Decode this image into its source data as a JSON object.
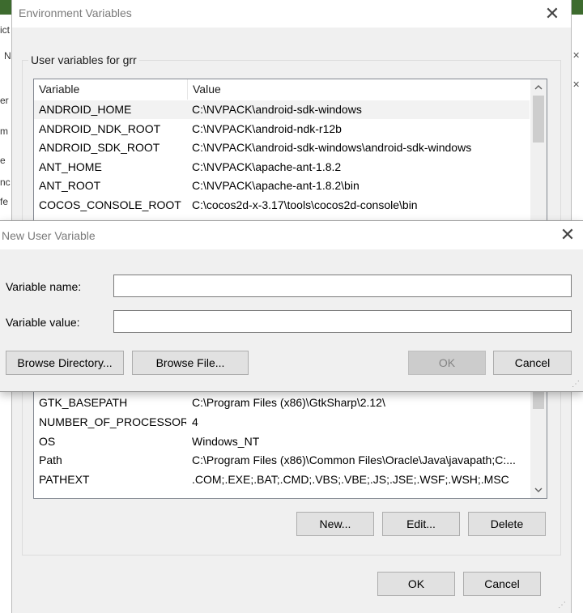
{
  "background": {
    "left_fragments": [
      "ict",
      "N",
      "er",
      "m",
      "e",
      "nc",
      "fe"
    ]
  },
  "env_window": {
    "title": "Environment Variables",
    "group_label": "User variables for grr",
    "columns": [
      "Variable",
      "Value"
    ],
    "rows_top": [
      {
        "name": "ANDROID_HOME",
        "value": "C:\\NVPACK\\android-sdk-windows"
      },
      {
        "name": "ANDROID_NDK_ROOT",
        "value": "C:\\NVPACK\\android-ndk-r12b"
      },
      {
        "name": "ANDROID_SDK_ROOT",
        "value": "C:\\NVPACK\\android-sdk-windows\\android-sdk-windows"
      },
      {
        "name": "ANT_HOME",
        "value": "C:\\NVPACK\\apache-ant-1.8.2"
      },
      {
        "name": "ANT_ROOT",
        "value": "C:\\NVPACK\\apache-ant-1.8.2\\bin"
      },
      {
        "name": "COCOS_CONSOLE_ROOT",
        "value": "C:\\cocos2d-x-3.17\\tools\\cocos2d-console\\bin"
      }
    ],
    "rows_bottom": [
      {
        "name": "GTK_BASEPATH",
        "value": "C:\\Program Files (x86)\\GtkSharp\\2.12\\"
      },
      {
        "name": "NUMBER_OF_PROCESSORS",
        "value": "4"
      },
      {
        "name": "OS",
        "value": "Windows_NT"
      },
      {
        "name": "Path",
        "value": "C:\\Program Files (x86)\\Common Files\\Oracle\\Java\\javapath;C:..."
      },
      {
        "name": "PATHEXT",
        "value": ".COM;.EXE;.BAT;.CMD;.VBS;.VBE;.JS;.JSE;.WSF;.WSH;.MSC"
      }
    ],
    "buttons": {
      "new": "New...",
      "edit": "Edit...",
      "delete": "Delete",
      "ok": "OK",
      "cancel": "Cancel"
    }
  },
  "dialog": {
    "title": "New User Variable",
    "name_label": "Variable name:",
    "value_label": "Variable value:",
    "name_value": "",
    "value_value": "",
    "buttons": {
      "browse_dir": "Browse Directory...",
      "browse_file": "Browse File...",
      "ok": "OK",
      "cancel": "Cancel"
    }
  },
  "icons": {
    "close": "close-icon",
    "scroll_up": "chevron-up-icon",
    "scroll_down": "chevron-down-icon",
    "grip": "resize-grip-icon"
  }
}
